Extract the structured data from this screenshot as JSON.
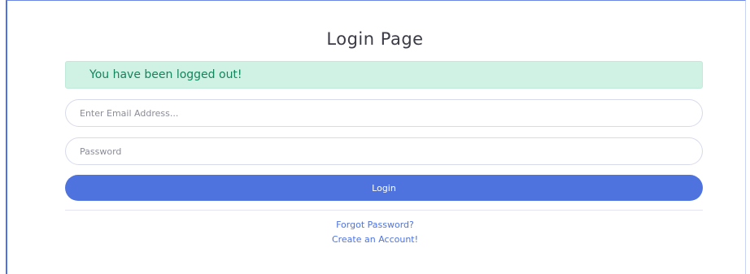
{
  "page": {
    "title": "Login Page"
  },
  "alert": {
    "message": "You have been logged out!"
  },
  "form": {
    "email_placeholder": "Enter Email Address...",
    "email_value": "",
    "password_placeholder": "Password",
    "password_value": "",
    "login_label": "Login"
  },
  "links": {
    "forgot_password": "Forgot Password?",
    "create_account": "Create an Account!"
  },
  "colors": {
    "primary": "#4e73df",
    "success_bg": "#d0f2e5",
    "success_text": "#13855c"
  }
}
